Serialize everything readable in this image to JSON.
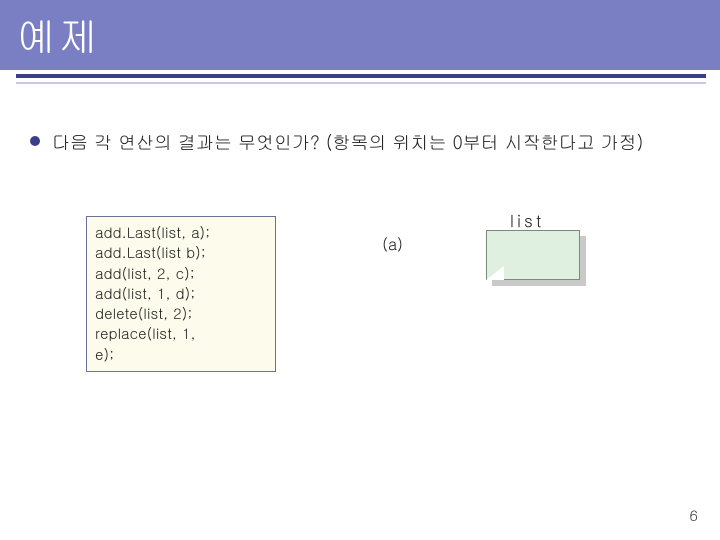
{
  "title": "예제",
  "bullet_text": "다음 각 연산의  결과는 무엇인가? (항목의 위치는 0부터 시작한다고 가정)",
  "code_lines": [
    "add.Last(list, a);",
    "add.Last(list b);",
    "add(list, 2, c);",
    "add(list, 1, d);",
    "delete(list, 2);",
    "replace(list, 1,",
    "e);"
  ],
  "result_label": "(a)",
  "list_label": "list",
  "page_number": "6"
}
